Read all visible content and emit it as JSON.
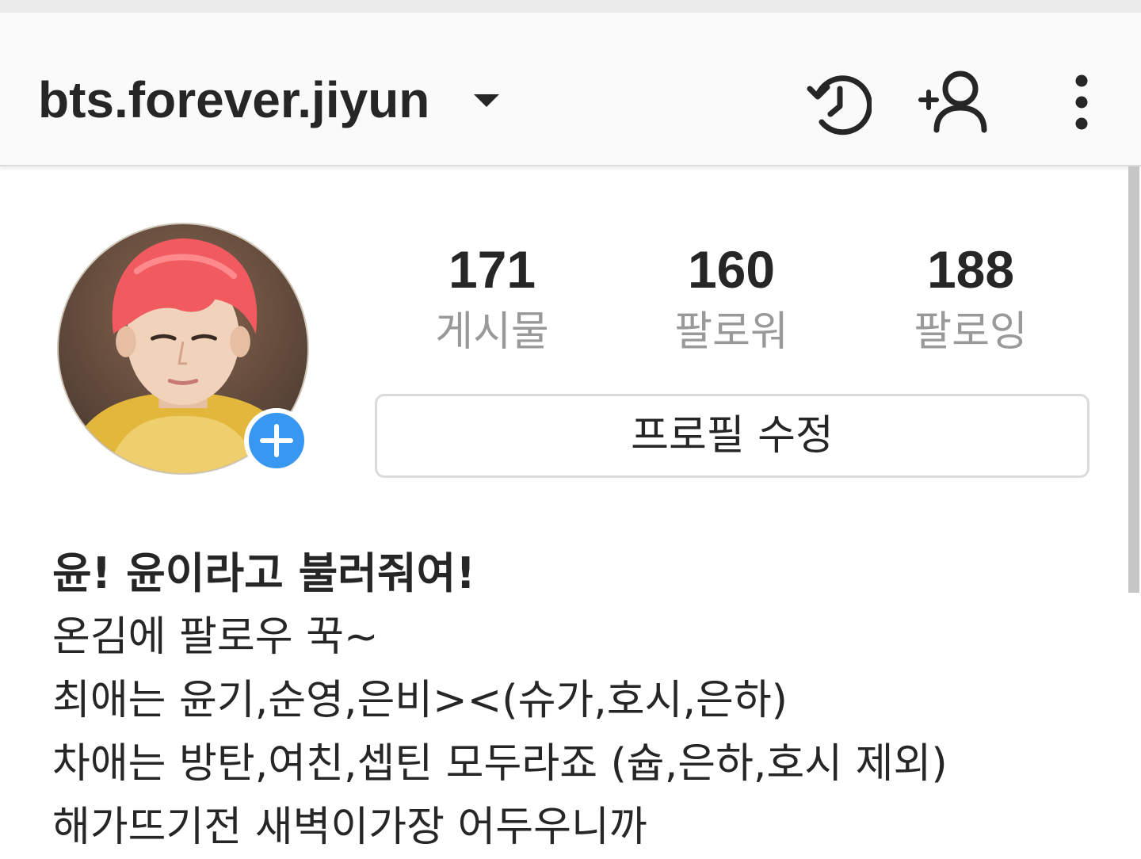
{
  "header": {
    "username": "bts.forever.jiyun",
    "icons": [
      "chevron-down-icon",
      "history-icon",
      "add-user-icon",
      "more-icon"
    ]
  },
  "profile": {
    "avatar_icon": "avatar",
    "stats": {
      "posts": {
        "value": "171",
        "label": "게시물"
      },
      "followers": {
        "value": "160",
        "label": "팔로워"
      },
      "following": {
        "value": "188",
        "label": "팔로잉"
      }
    },
    "edit_button_label": "프로필 수정"
  },
  "bio": {
    "name": "윤! 윤이라고 불러줘여!",
    "lines": [
      "온김에 팔로우 꾹~",
      "최애는 윤기,순영,은비><(슈가,호시,은하)",
      "차애는 방탄,여친,셉틴 모두라죠 (슙,은하,호시 제외)",
      "해가뜨기전 새벽이가장 어두우니까"
    ]
  },
  "colors": {
    "accent_blue": "#3897f0",
    "text_primary": "#262626",
    "text_secondary": "#999999",
    "border": "#dbdbdb"
  }
}
